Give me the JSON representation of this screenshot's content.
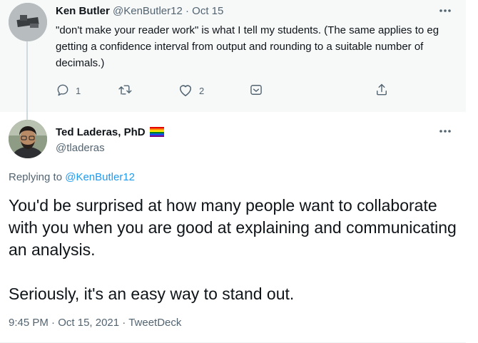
{
  "parent_tweet": {
    "author_name": "Ken Butler",
    "author_handle": "@KenButler12",
    "separator": "·",
    "date": "Oct 15",
    "text": "\"don't make your reader work\" is what I tell my students. (The same applies to eg getting a confidence interval from output and rounding to a suitable number of decimals.)",
    "replies_count": "1",
    "likes_count": "2",
    "icons": [
      "reply-icon",
      "retweet-icon",
      "like-icon",
      "revue-icon",
      "share-icon",
      "more-icon"
    ]
  },
  "main_tweet": {
    "author_name": "Ted Laderas, PhD",
    "author_handle": "@tladeras",
    "replying_to_prefix": "Replying to",
    "replying_to_handle": "@KenButler12",
    "text_paragraph_1": "You'd be surprised at how many people want to collaborate with you when you are good at explaining and communicating an analysis.",
    "text_paragraph_2": "Seriously, it's an easy way to stand out.",
    "time": "9:45 PM",
    "date": "Oct 15, 2021",
    "source": "TweetDeck",
    "meta_separator": "·",
    "icons": [
      "rainbow-flag-icon",
      "more-icon"
    ]
  },
  "colors": {
    "accent": "#1d9bf0",
    "secondary_text": "#536471",
    "parent_background": "#f7f9f9"
  }
}
